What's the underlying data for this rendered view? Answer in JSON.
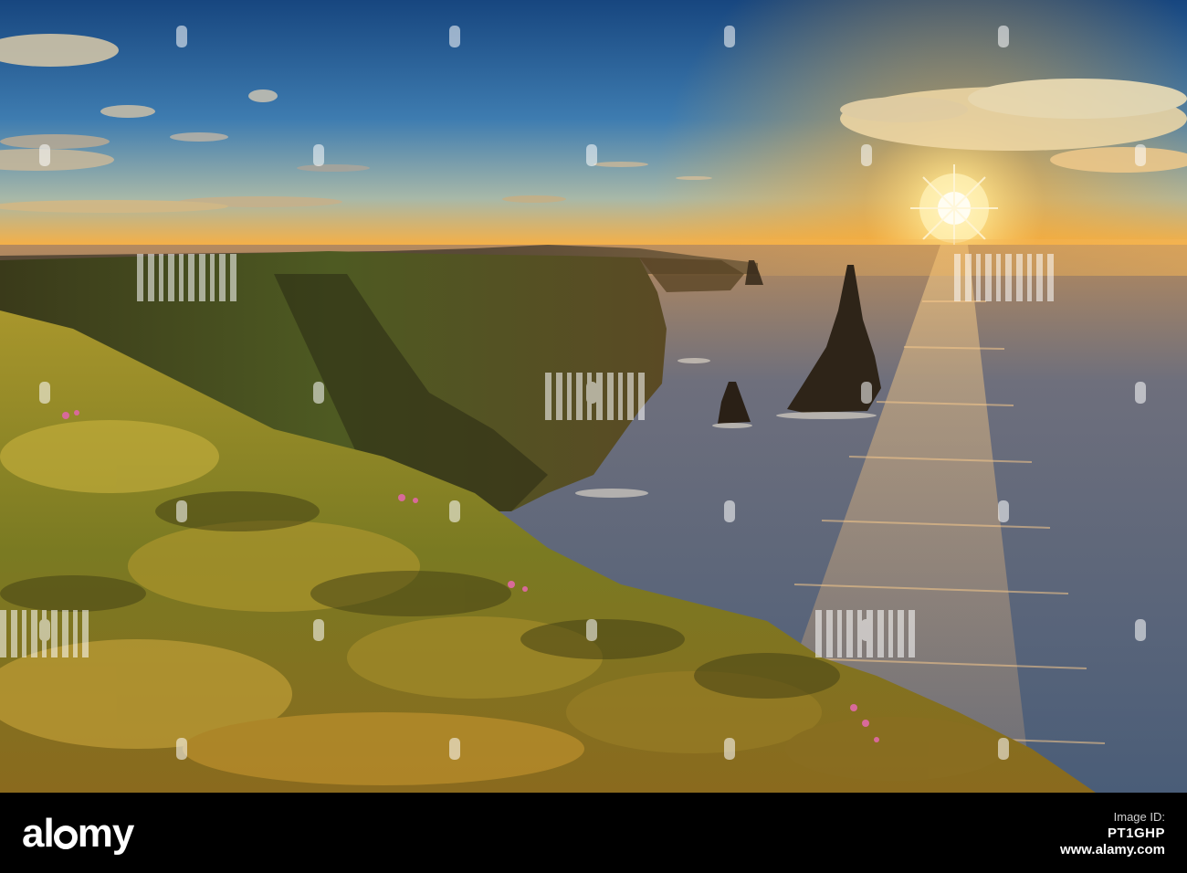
{
  "photo": {
    "subject": "sea cliffs and sea stacks at sunset",
    "colors": {
      "sky_top": "#1f4f86",
      "sky_mid": "#4f8ab8",
      "horizon_glow": "#f6a52c",
      "sun": "#fff6d0",
      "sea": "#5b6f8a",
      "sea_glint": "#f3b86a",
      "cliff_shadow": "#2f2a16",
      "grass_lit": "#b9a23a"
    }
  },
  "watermark": {
    "brand": "alamy",
    "brand_prefix": "al",
    "brand_suffix": "my"
  },
  "footer": {
    "brand_prefix": "al",
    "brand_suffix": "my",
    "image_id_label": "Image ID:",
    "image_id": "PT1GHP",
    "site": "www.alamy.com"
  }
}
